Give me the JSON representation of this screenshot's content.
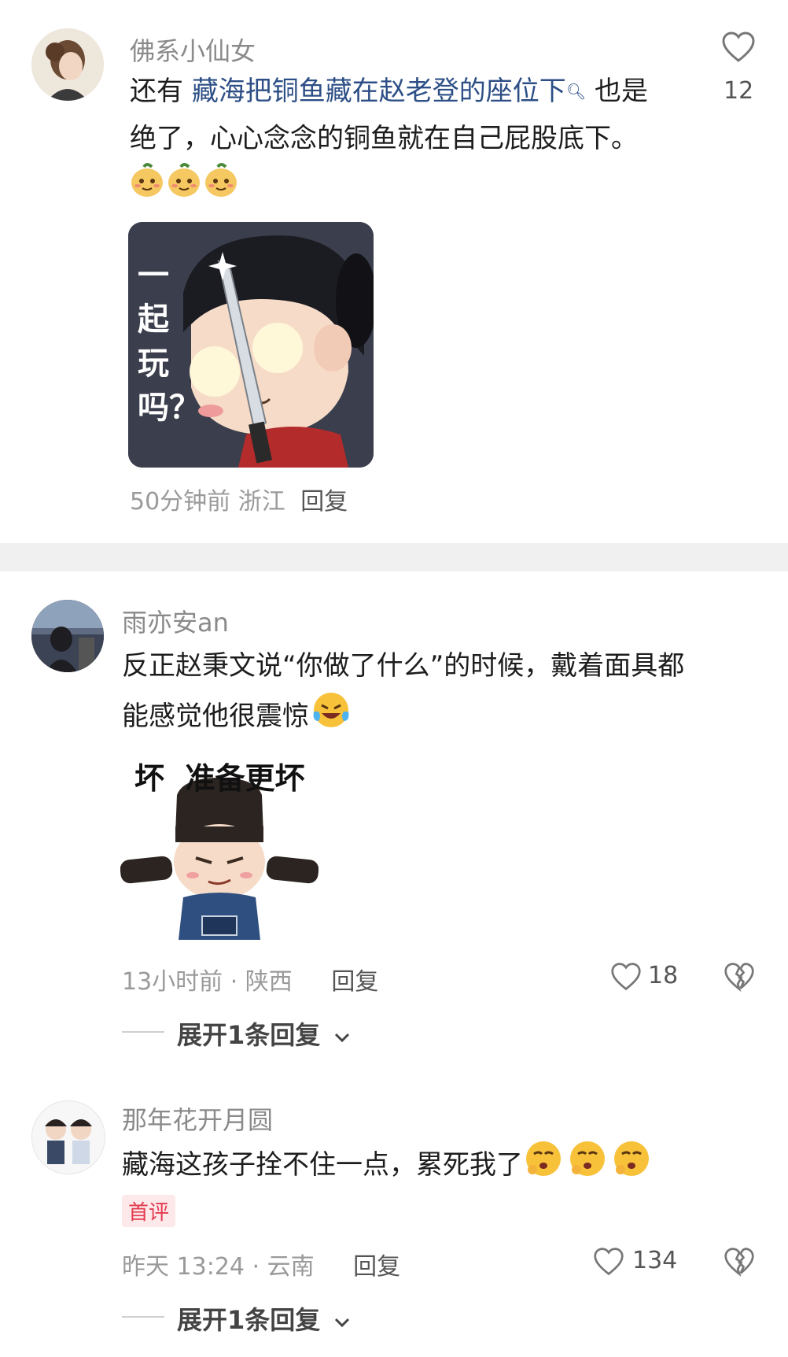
{
  "comments": [
    {
      "username": "佛系小仙女",
      "text_pre": "还有 ",
      "text_link": "藏海把铜鱼藏在赵老登的座位下",
      "text_post": " 也是",
      "text_line2": "绝了，心心念念的铜鱼就在自己屁股底下。",
      "emoji_icon": "smirk-fruit-emoji",
      "sticker_text": "一起玩吗？",
      "meta": "50分钟前 浙江",
      "reply_label": "回复",
      "like_count": "12"
    },
    {
      "username": "雨亦安an",
      "text_line1": "反正赵秉文说“你做了什么”的时候，戴着面具都",
      "text_line2": "能感觉他很震惊",
      "emoji_icon": "laughing-tears-emoji",
      "sticker_text": "坏  准备更坏",
      "meta": "13小时前 · 陕西",
      "reply_label": "回复",
      "like_count": "18",
      "expand_label": "展开1条回复"
    },
    {
      "username": "那年花开月圆",
      "text_line1": "藏海这孩子拴不住一点，累死我了",
      "emoji_icon": "tired-emoji",
      "badge": "首评",
      "meta": "昨天 13:24 · 云南",
      "reply_label": "回复",
      "like_count": "134",
      "expand_label": "展开1条回复"
    }
  ]
}
